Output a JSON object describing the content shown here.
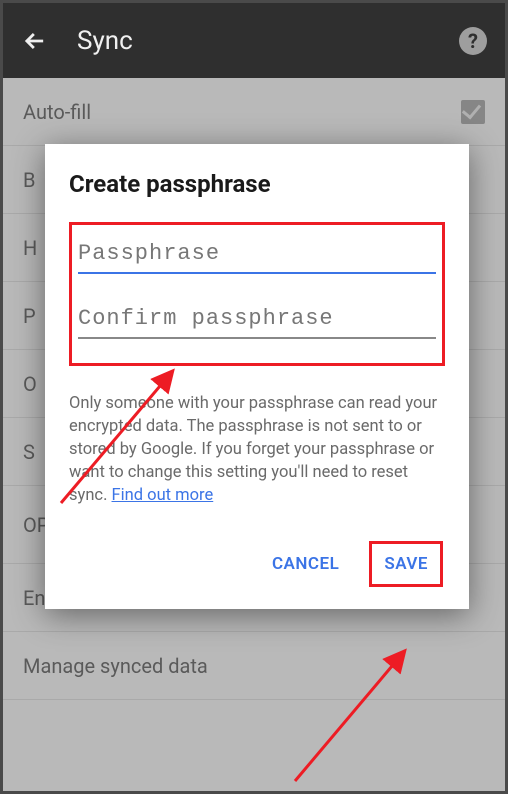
{
  "topbar": {
    "title": "Sync",
    "help": "?"
  },
  "list": {
    "items": [
      {
        "label": "Auto-fill"
      },
      {
        "label": "B"
      },
      {
        "label": "H"
      },
      {
        "label": "P"
      },
      {
        "label": "O"
      },
      {
        "label": "S"
      },
      {
        "label": "OP"
      },
      {
        "label": "Encryption"
      },
      {
        "label": "Manage synced data"
      }
    ]
  },
  "dialog": {
    "title": "Create passphrase",
    "passphrase_placeholder": "Passphrase",
    "confirm_placeholder": "Confirm passphrase",
    "body_text": "Only someone with your passphrase can read your encrypted data. The passphrase is not sent to or stored by Google. If you forget your passphrase or want to change this setting you'll need to reset sync. ",
    "find_out_more": "Find out more",
    "cancel": "CANCEL",
    "save": "SAVE"
  }
}
